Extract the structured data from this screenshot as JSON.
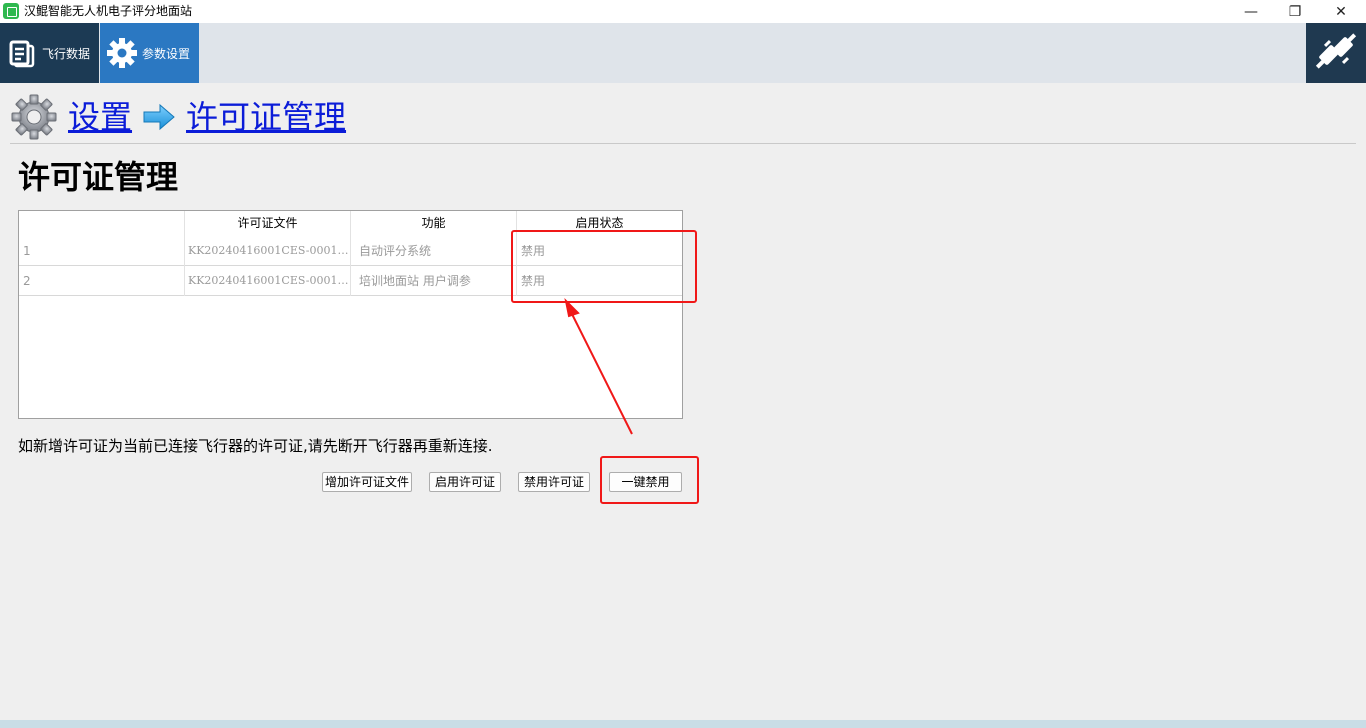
{
  "window": {
    "title": "汉鲲智能无人机电子评分地面站",
    "minimize_glyph": "—",
    "maximize_glyph": "❐",
    "close_glyph": "✕"
  },
  "toolbar": {
    "tabs": [
      {
        "label": "飞行数据",
        "icon": "document-icon"
      },
      {
        "label": "参数设置",
        "icon": "gear-icon"
      }
    ],
    "active_tab": "参数设置",
    "connect_icon": "plug-disconnect-icon"
  },
  "breadcrumb": {
    "items": [
      "设置",
      "许可证管理"
    ],
    "separator_icon": "arrow-right-icon"
  },
  "page": {
    "title": "许可证管理",
    "hint": "如新增许可证为当前已连接飞行器的许可证,请先断开飞行器再重新连接."
  },
  "table": {
    "columns": [
      "",
      "许可证文件",
      "功能",
      "启用状态"
    ],
    "rows": [
      {
        "index": "1",
        "file": "KK20240416001CES-0001…",
        "function": "自动评分系统",
        "status": "禁用"
      },
      {
        "index": "2",
        "file": "KK20240416001CES-0001…",
        "function": "培训地面站 用户调参",
        "status": "禁用"
      }
    ]
  },
  "buttons": {
    "add": "增加许可证文件",
    "enable": "启用许可证",
    "disable": "禁用许可证",
    "disable_all": "一键禁用"
  },
  "colors": {
    "accent": "#2b78c2",
    "toolbar_dark": "#1c3a54",
    "link": "#0b1cd8",
    "annotation": "#f01818"
  }
}
